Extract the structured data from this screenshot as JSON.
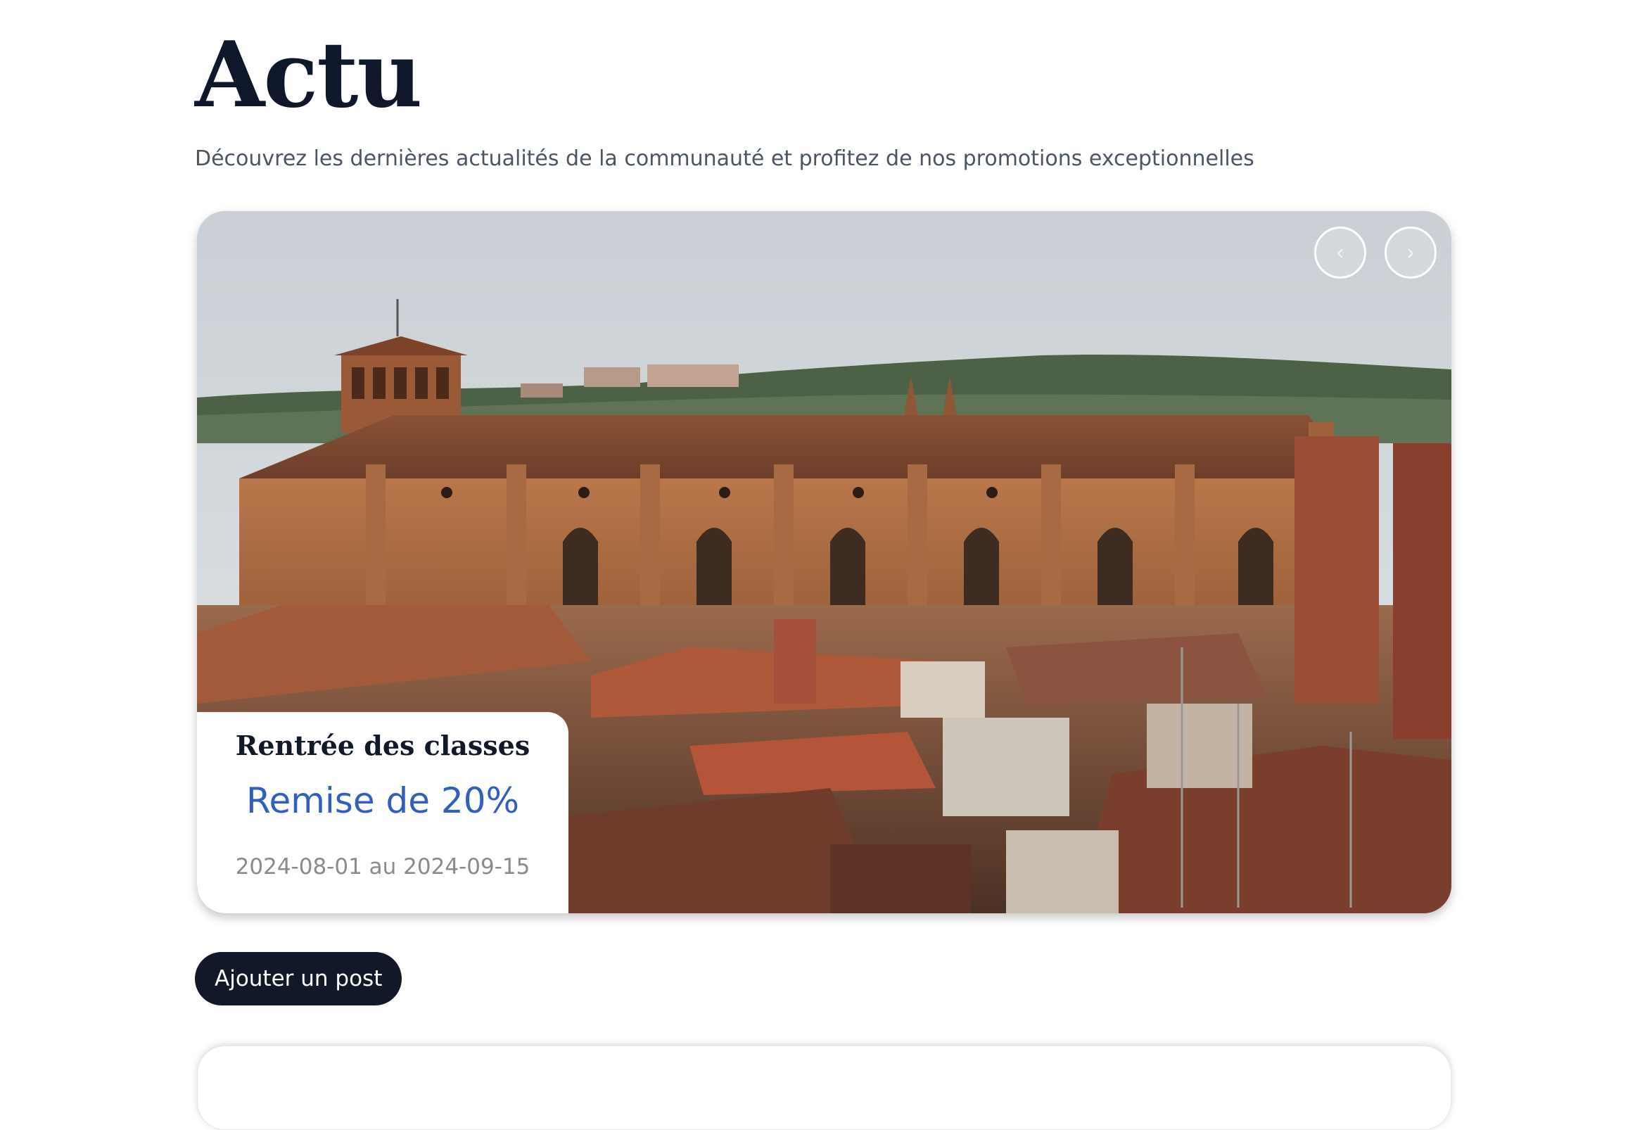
{
  "header": {
    "title": "Actu",
    "subtitle": "Découvrez les dernières actualités de la communauté et profitez de nos promotions exceptionnelles"
  },
  "carousel": {
    "prev_icon": "chevron-left-icon",
    "prev_glyph": "‹",
    "next_icon": "chevron-right-icon",
    "next_glyph": "›",
    "slide": {
      "image": "church-rooftops-photo",
      "promo": {
        "title": "Rentrée des classes",
        "discount": "Remise de 20%",
        "dates": "2024-08-01 au 2024-09-15"
      }
    }
  },
  "actions": {
    "add_post_label": "Ajouter un post"
  },
  "colors": {
    "primary_dark": "#111827",
    "accent_blue": "#2f5fbf",
    "muted_text": "#8b8b8b"
  }
}
